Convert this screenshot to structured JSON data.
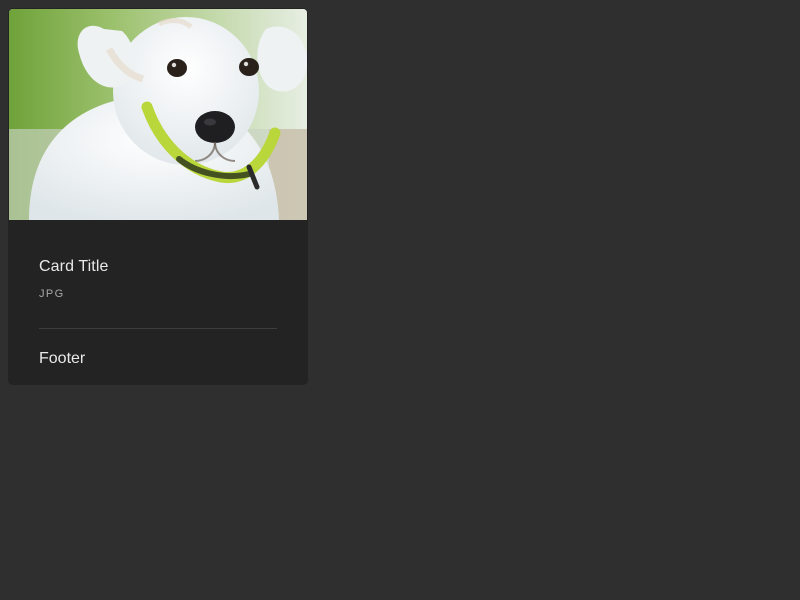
{
  "card": {
    "title": "Card Title",
    "subtitle": "JPG",
    "footer": "Footer",
    "image_alt": "White puppy with a yellow collar"
  }
}
